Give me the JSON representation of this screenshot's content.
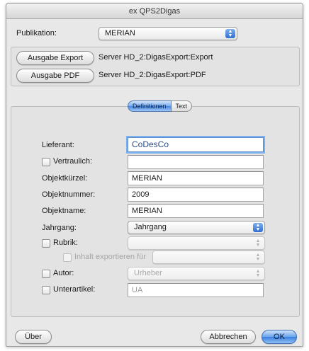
{
  "window": {
    "title": "ex QPS2Digas"
  },
  "publication": {
    "label": "Publikation:",
    "selected": "MERIAN"
  },
  "output": {
    "export_button": "Ausgabe Export",
    "export_path": "Server HD_2:DigasExport:Export",
    "pdf_button": "Ausgabe PDF",
    "pdf_path": "Server HD_2:DigasExport:PDF"
  },
  "tabs": [
    {
      "label": "Definitionen",
      "active": true
    },
    {
      "label": "Text",
      "active": false
    }
  ],
  "form": {
    "lieferant": {
      "label": "Lieferant:",
      "value": "CoDesCo"
    },
    "vertraulich": {
      "label": "Vertraulich:",
      "value": ""
    },
    "objektkuerzel": {
      "label": "Objektkürzel:",
      "value": "MERIAN"
    },
    "objektnummer": {
      "label": "Objektnummer:",
      "value": "2009"
    },
    "objektname": {
      "label": "Objektname:",
      "value": "MERIAN"
    },
    "jahrgang": {
      "label": "Jahrgang:",
      "selected": "Jahrgang"
    },
    "rubrik": {
      "label": "Rubrik:",
      "selected": ""
    },
    "inhalt": {
      "label": "Inhalt exportieren für",
      "selected": ""
    },
    "autor": {
      "label": "Autor:",
      "selected": "Urheber"
    },
    "unterartikel": {
      "label": "Unterartikel:",
      "value": "UA"
    }
  },
  "footer": {
    "about_button": "Über",
    "cancel_button": "Abbrechen",
    "ok_button": "OK"
  }
}
